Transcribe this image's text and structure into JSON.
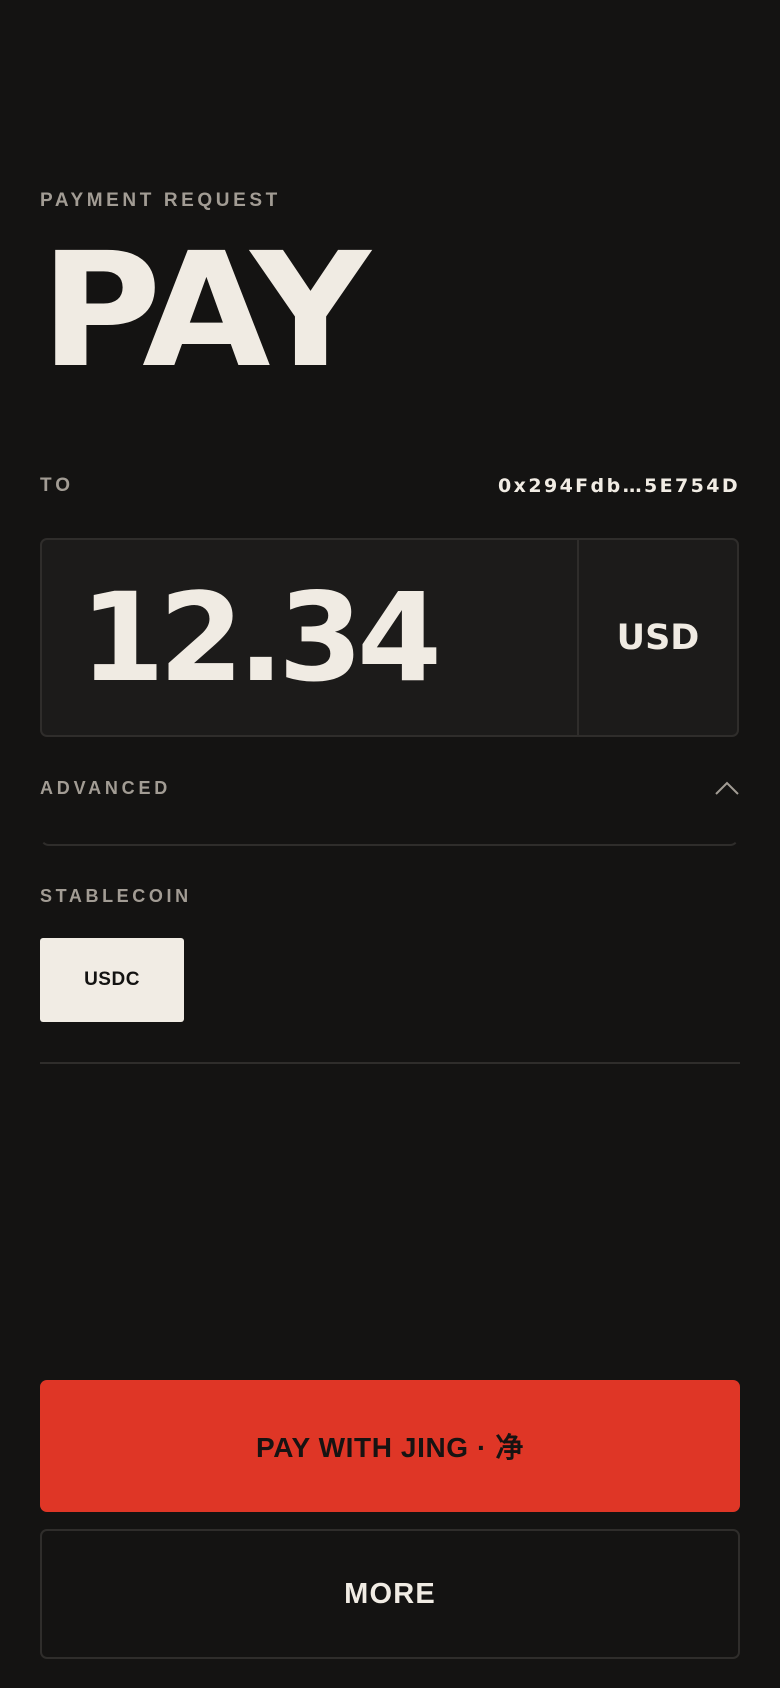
{
  "header": {
    "eyebrow": "PAYMENT REQUEST",
    "title": "PAY"
  },
  "recipient": {
    "label": "TO",
    "address": "0x294Fdb…5E754D"
  },
  "amount": {
    "value": "12.34",
    "currency": "USD"
  },
  "advanced": {
    "label": "ADVANCED",
    "expanded": true,
    "icon": "chevron-up-icon"
  },
  "stablecoin": {
    "label": "STABLECOIN",
    "options": [
      "USDC"
    ],
    "selected": "USDC"
  },
  "actions": {
    "primary_label": "PAY WITH JING · 净",
    "secondary_label": "MORE"
  },
  "colors": {
    "background": "#141312",
    "text": "#f1ece4",
    "muted": "#a29c94",
    "accent": "#df3626",
    "border": "#2f2d2b"
  }
}
